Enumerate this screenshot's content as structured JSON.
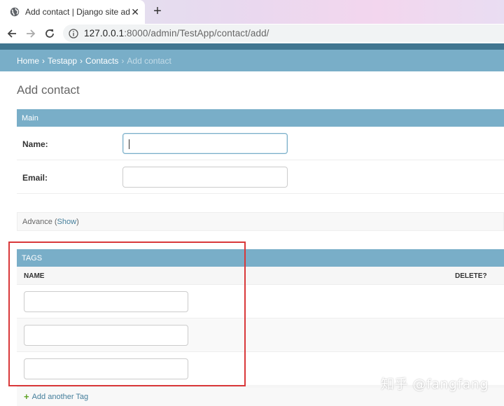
{
  "browser": {
    "tab_title": "Add contact | Django site adm",
    "tab_close": "✕",
    "new_tab": "+",
    "url_host": "127.0.0.1",
    "url_path": ":8000/admin/TestApp/contact/add/"
  },
  "breadcrumbs": {
    "home": "Home",
    "app": "Testapp",
    "model": "Contacts",
    "current": "Add contact",
    "separator": "›"
  },
  "page": {
    "title": "Add contact"
  },
  "main_fieldset": {
    "header": "Main",
    "name_label": "Name:",
    "name_value": "",
    "email_label": "Email:",
    "email_value": ""
  },
  "advance_fieldset": {
    "label": "Advance (",
    "toggle": "Show",
    "close": ")"
  },
  "tags_inline": {
    "header": "TAGS",
    "col_name": "NAME",
    "col_delete": "DELETE?",
    "rows": [
      {
        "name": ""
      },
      {
        "name": ""
      },
      {
        "name": ""
      }
    ],
    "add_another": "Add another Tag"
  },
  "watermark": "知乎 @fangfang",
  "colors": {
    "django_dark": "#417690",
    "django_light": "#79aec8",
    "link": "#447e9b",
    "highlight": "#d9383a"
  }
}
